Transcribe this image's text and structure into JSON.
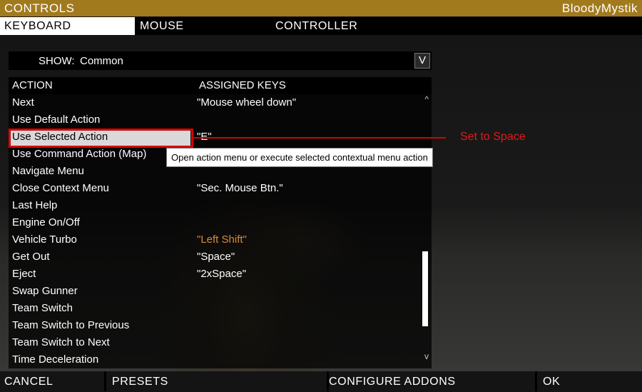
{
  "window": {
    "title": "CONTROLS",
    "user": "BloodyMystik"
  },
  "tabs": {
    "keyboard": "KEYBOARD",
    "mouse": "MOUSE",
    "controller": "CONTROLLER"
  },
  "filter": {
    "label": "SHOW:",
    "value": "Common",
    "dropdown_glyph": "V"
  },
  "table": {
    "headers": {
      "action": "ACTION",
      "keys": "ASSIGNED KEYS"
    },
    "rows": [
      {
        "action": "Next",
        "keys": "\"Mouse wheel down\""
      },
      {
        "action": "Use Default Action",
        "keys": ""
      },
      {
        "action": "Use Selected Action",
        "keys": "\"E\""
      },
      {
        "action": "Use Command Action (Map)",
        "keys": ""
      },
      {
        "action": "Navigate Menu",
        "keys": ""
      },
      {
        "action": "Close Context Menu",
        "keys": "\"Sec. Mouse Btn.\""
      },
      {
        "action": "Last Help",
        "keys": ""
      },
      {
        "action": "Engine On/Off",
        "keys": ""
      },
      {
        "action": "Vehicle Turbo",
        "keys": "\"Left Shift\""
      },
      {
        "action": "Get Out",
        "keys": "\"Space\""
      },
      {
        "action": "Eject",
        "keys": "\"2xSpace\""
      },
      {
        "action": "Swap Gunner",
        "keys": ""
      },
      {
        "action": "Team Switch",
        "keys": ""
      },
      {
        "action": "Team Switch to Previous",
        "keys": ""
      },
      {
        "action": "Team Switch to Next",
        "keys": ""
      },
      {
        "action": "Time Deceleration",
        "keys": ""
      }
    ],
    "scroll_up": "^",
    "scroll_down": "v"
  },
  "tooltip": "Open action menu or execute selected contextual menu action",
  "annotation": {
    "note": "Set to Space",
    "color": "#d90000"
  },
  "buttons": {
    "cancel": "CANCEL",
    "presets": "PRESETS",
    "configure_addons": "CONFIGURE ADDONS",
    "ok": "OK"
  },
  "colors": {
    "titlebar": "#a27a1e",
    "highlight_key": "#d88a3a"
  }
}
